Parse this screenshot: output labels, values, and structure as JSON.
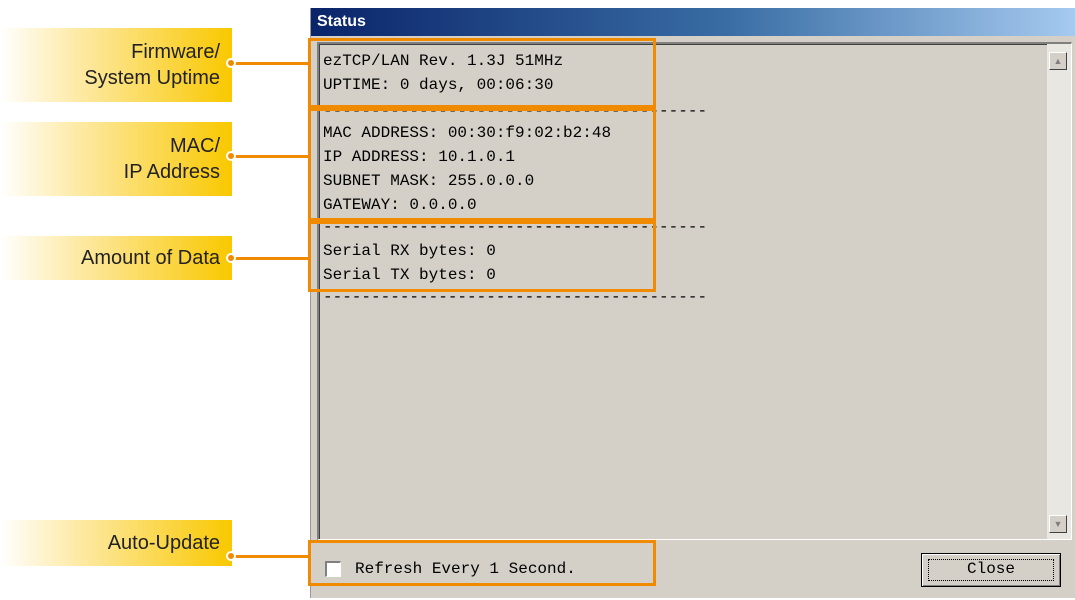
{
  "window": {
    "title": "Status",
    "status_lines": [
      "ezTCP/LAN Rev. 1.3J 51MHz",
      "UPTIME: 0 days, 00:06:30",
      "----------------------------------------",
      "MAC ADDRESS: 00:30:f9:02:b2:48",
      "IP ADDRESS: 10.1.0.1",
      "SUBNET MASK: 255.0.0.0",
      "GATEWAY: 0.0.0.0",
      "----------------------------------------",
      "Serial RX bytes: 0",
      "Serial TX bytes: 0",
      "----------------------------------------"
    ],
    "refresh_label": "Refresh Every 1 Second.",
    "refresh_checked": false,
    "close_label": "Close",
    "scroll_up_icon": "arrow-up-icon",
    "scroll_down_icon": "arrow-down-icon"
  },
  "annotations": [
    {
      "lines": [
        "Firmware/",
        "System Uptime"
      ]
    },
    {
      "lines": [
        "MAC/",
        "IP Address"
      ]
    },
    {
      "lines": [
        "Amount of Data"
      ]
    },
    {
      "lines": [
        "Auto-Update"
      ]
    }
  ],
  "colors": {
    "accent": "#f08a00",
    "callout_fill": "#f9c800",
    "titlebar_start": "#0a246a",
    "titlebar_end": "#a6caf0",
    "dialog_bg": "#d4d0c8"
  }
}
